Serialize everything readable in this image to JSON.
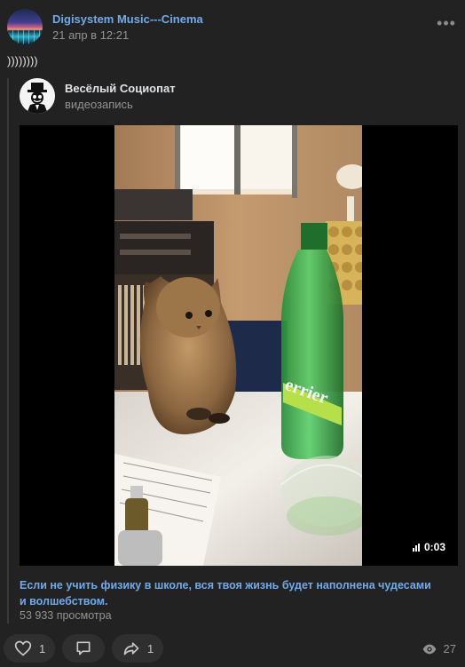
{
  "post": {
    "author": "Digisystem Music---Cinema",
    "date": "21 апр в 12:21",
    "text": "))))))))"
  },
  "repost": {
    "author": "Весёлый Социопат",
    "type": "видеозапись"
  },
  "video": {
    "duration": "0:03",
    "bottle_label": "errier"
  },
  "caption": "Если не учить физику в школе, вся твоя жизнь будет наполнена чудесами и волшебством.",
  "views_text": "53 933 просмотра",
  "actions": {
    "like_count": "1",
    "comment_count": "",
    "share_count": "1",
    "views_count": "27"
  },
  "icons": {
    "more": "more-icon",
    "like": "heart-icon",
    "comment": "comment-icon",
    "share": "share-icon",
    "views": "eye-icon",
    "duration": "bars-icon"
  },
  "colors": {
    "background": "#222222",
    "link": "#71aaeb",
    "secondary": "#939393",
    "button": "#2f2f2f"
  }
}
